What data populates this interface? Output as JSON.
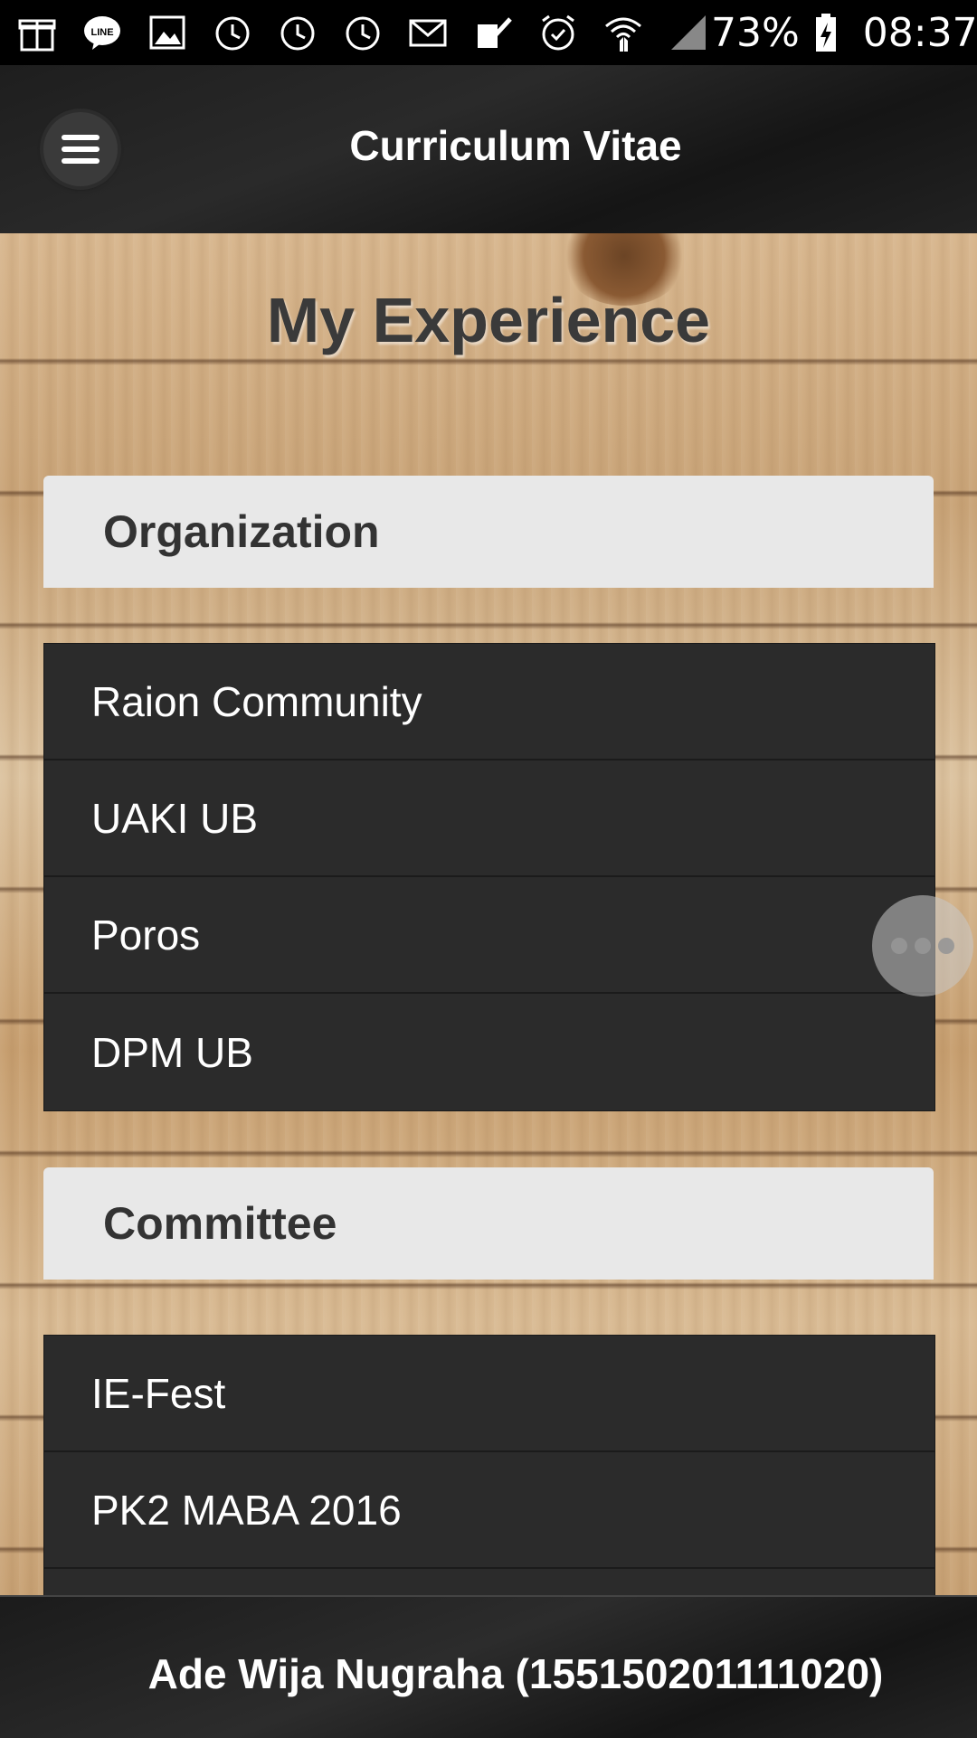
{
  "status_bar": {
    "icons": [
      "gift-icon",
      "line-icon",
      "gallery-icon",
      "alarm-icon",
      "alarm-icon",
      "alarm-icon",
      "mail-icon",
      "task-icon",
      "alarm-clock-icon",
      "wifi-icon",
      "signal-icon"
    ],
    "battery_percent": "73%",
    "time": "08:37"
  },
  "header": {
    "title": "Curriculum Vitae"
  },
  "main": {
    "title": "My Experience",
    "sections": [
      {
        "title": "Organization",
        "items": [
          "Raion Community",
          "UAKI UB",
          "Poros",
          "DPM UB"
        ]
      },
      {
        "title": "Committee",
        "items": [
          "IE-Fest",
          "PK2 MABA 2016"
        ]
      }
    ]
  },
  "footer": {
    "text": "Ade Wija Nugraha (155150201111020)"
  },
  "colors": {
    "header_bg": "#222222",
    "section_header_bg": "#e8e8e8",
    "list_bg": "#2b2b2b",
    "text_light": "#ffffff",
    "text_dark": "#333333"
  }
}
